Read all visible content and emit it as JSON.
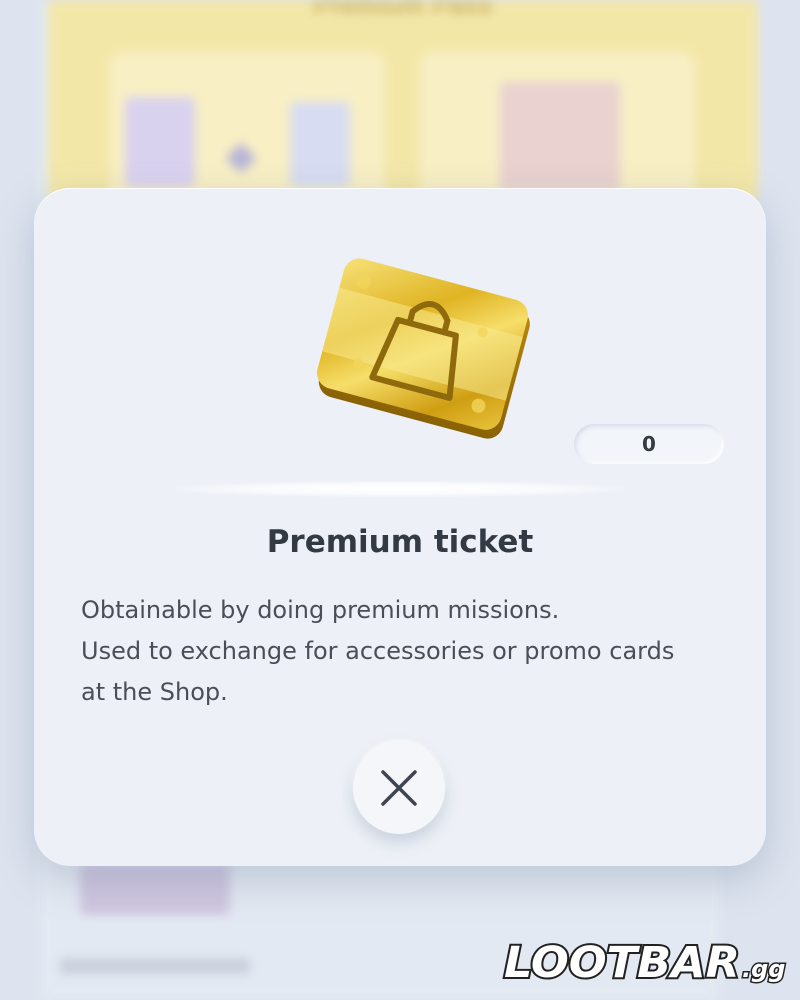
{
  "background": {
    "pass_title": "Premium Pass"
  },
  "modal": {
    "item_icon": "premium-ticket-shopping-bag-icon",
    "count": "0",
    "title": "Premium ticket",
    "description_lines": [
      "Obtainable by doing premium missions.",
      "Used to exchange for accessories or promo cards",
      "at the Shop."
    ],
    "close_icon": "close-x-icon"
  },
  "watermark": {
    "brand": "LOOTBAR",
    "suffix": ".gg"
  },
  "colors": {
    "modal_bg": "#edf1f7",
    "gold": "#d6ac16",
    "title_text": "#343a44",
    "body_text": "#4a4f57",
    "background_pass": "#f3e7a8"
  }
}
